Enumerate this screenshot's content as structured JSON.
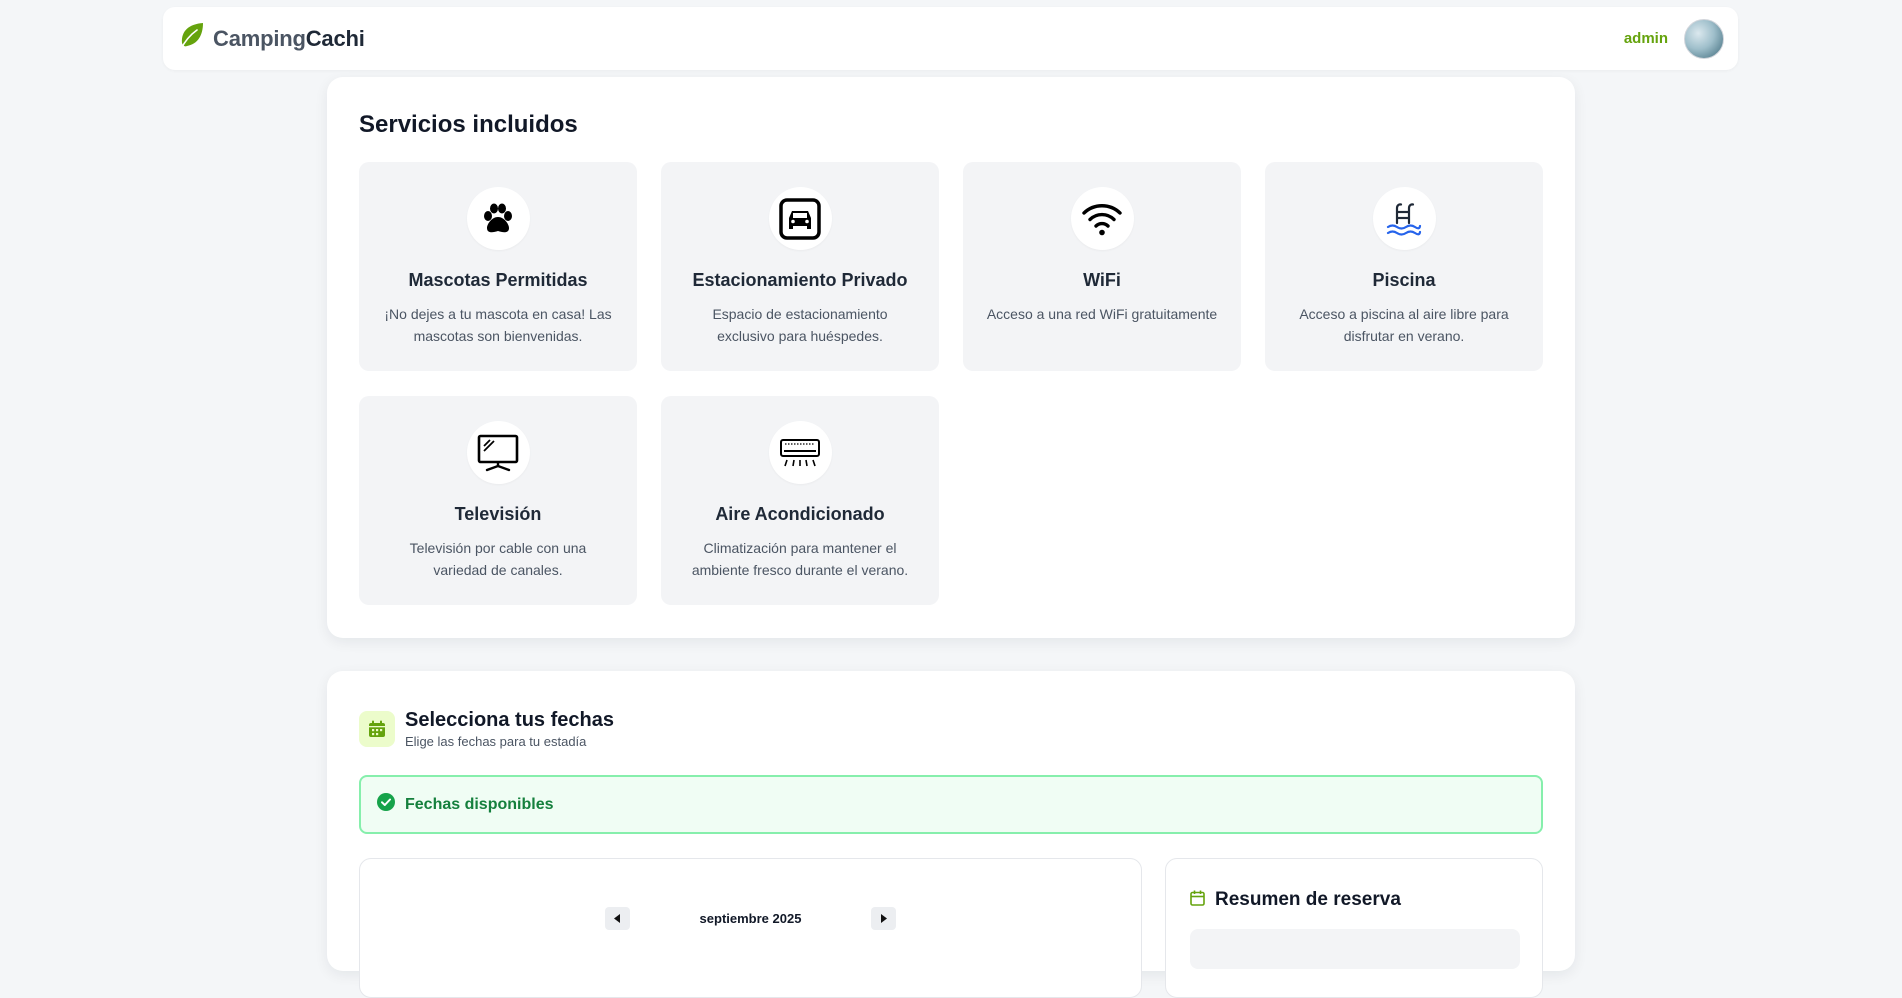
{
  "navbar": {
    "brand_part1": "Camping",
    "brand_part2": "Cachi",
    "username": "admin",
    "icons": {
      "logo": "leaf-icon",
      "avatar": "user-avatar"
    },
    "colors": {
      "brand_green": "#65a30d",
      "leaf_green": "#65a30d"
    }
  },
  "services": {
    "title": "Servicios incluidos",
    "items": [
      {
        "title": "Mascotas Permitidas",
        "desc": "¡No dejes a tu mascota en casa! Las mascotas son bienvenidas.",
        "icon": "paw-icon"
      },
      {
        "title": "Estacionamiento Privado",
        "desc": "Espacio de estacionamiento exclusivo para huéspedes.",
        "icon": "car-icon"
      },
      {
        "title": "WiFi",
        "desc": "Acceso a una red WiFi gratuitamente",
        "icon": "wifi-icon"
      },
      {
        "title": "Piscina",
        "desc": "Acceso a piscina al aire libre para disfrutar en verano.",
        "icon": "pool-icon"
      },
      {
        "title": "Televisión",
        "desc": "Televisión por cable con una variedad de canales.",
        "icon": "tv-icon"
      },
      {
        "title": "Aire Acondicionado",
        "desc": "Climatización para mantener el ambiente fresco durante el verano.",
        "icon": "air-conditioner-icon"
      }
    ]
  },
  "dates": {
    "title": "Selecciona tus fechas",
    "subtitle": "Elige las fechas para tu estadía",
    "alert": "Fechas disponibles",
    "calendar": {
      "month": "septiembre 2025"
    },
    "summary_title": "Resumen de reserva",
    "colors": {
      "success_bg": "#f0fdf4",
      "success_border": "#86efac",
      "success_text": "#15803d"
    }
  }
}
